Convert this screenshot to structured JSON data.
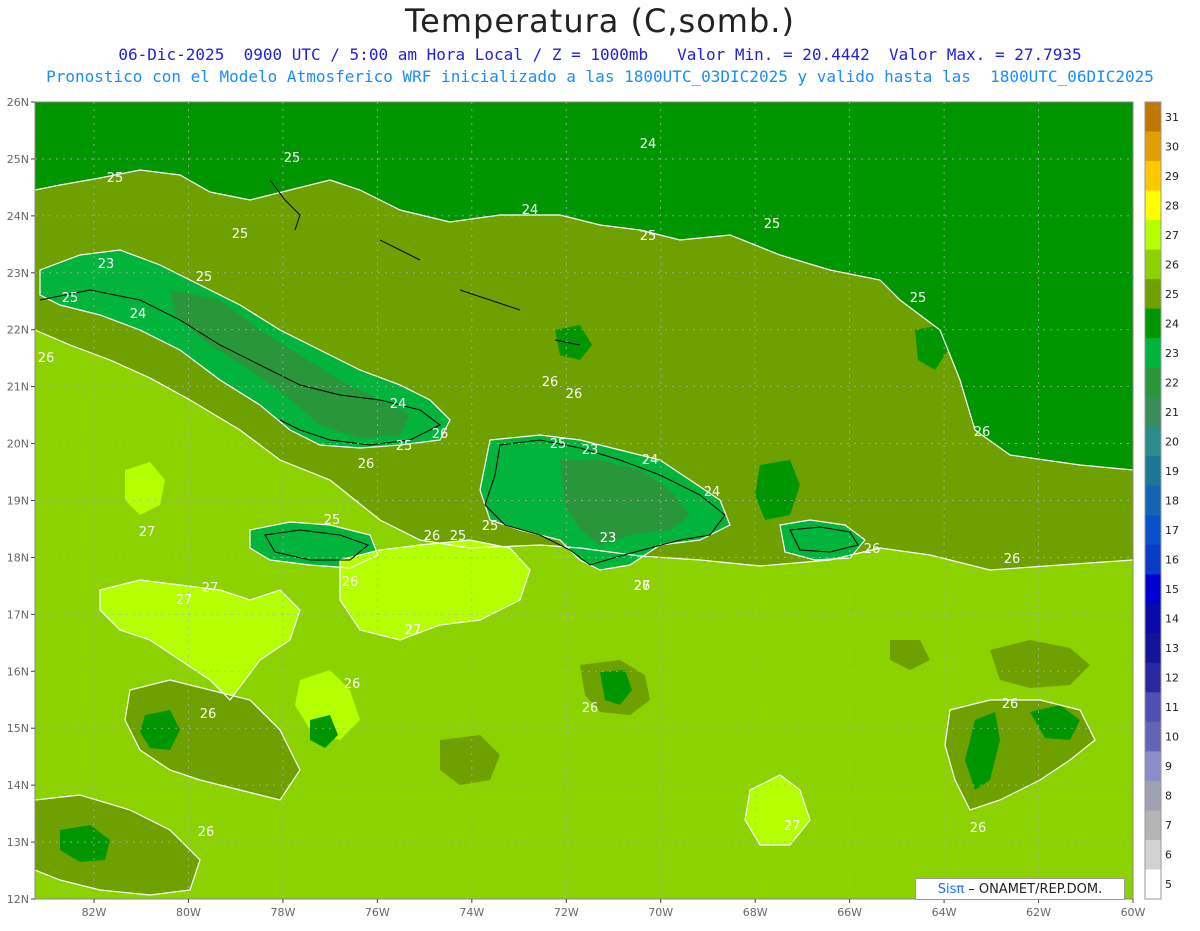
{
  "header": {
    "title": "Temperatura (C,somb.)",
    "line1": "06-Dic-2025  0900 UTC / 5:00 am Hora Local / Z = 1000mb   Valor Min. = 20.4442  Valor Max. = 27.7935",
    "line2": "Pronostico con el Modelo Atmosferico WRF inicializado a las 1800UTC_03DIC2025 y valido hasta las  1800UTC_06DIC2025"
  },
  "map": {
    "lat_labels": [
      "26N",
      "25N",
      "24N",
      "23N",
      "22N",
      "21N",
      "20N",
      "19N",
      "18N",
      "17N",
      "16N",
      "15N",
      "14N",
      "13N",
      "12N"
    ],
    "lon_labels": [
      "82W",
      "80W",
      "78W",
      "76W",
      "74W",
      "72W",
      "70W",
      "68W",
      "66W",
      "64W",
      "62W",
      "60W"
    ],
    "contour_labels": [
      "25",
      "25",
      "25",
      "24",
      "23",
      "25",
      "25",
      "24",
      "24",
      "25",
      "25",
      "25",
      "26",
      "24",
      "25",
      "26",
      "26",
      "23",
      "24",
      "25",
      "26",
      "25",
      "23",
      "24",
      "26",
      "25",
      "25",
      "26",
      "27",
      "27",
      "27",
      "27",
      "26",
      "27",
      "26",
      "26",
      "26",
      "26",
      "26",
      "26",
      "26",
      "27",
      "26",
      "26",
      "26"
    ]
  },
  "colorbar": {
    "levels": [
      "31",
      "30",
      "29",
      "28",
      "27",
      "26",
      "25",
      "24",
      "23",
      "22",
      "21",
      "20",
      "19",
      "18",
      "17",
      "16",
      "15",
      "14",
      "13",
      "12",
      "11",
      "10",
      "9",
      "8",
      "7",
      "6",
      "5"
    ],
    "colors": [
      "#c07800",
      "#e0a000",
      "#ffc800",
      "#ffff00",
      "#b4ff00",
      "#8cd200",
      "#6ea000",
      "#009600",
      "#00b43c",
      "#2a963c",
      "#3a8c5a",
      "#2a8c8c",
      "#1a7896",
      "#1464b4",
      "#0a50c8",
      "#0a3cc8",
      "#0000d2",
      "#0a0aaa",
      "#141496",
      "#2828a0",
      "#5050b4",
      "#6464b4",
      "#8c8cc8",
      "#a0a0b4",
      "#b4b4b4",
      "#d2d2d2",
      "#ffffff"
    ]
  },
  "credit": {
    "sis": "Sisπ",
    "text": "– ONAMET/REP.DOM."
  }
}
